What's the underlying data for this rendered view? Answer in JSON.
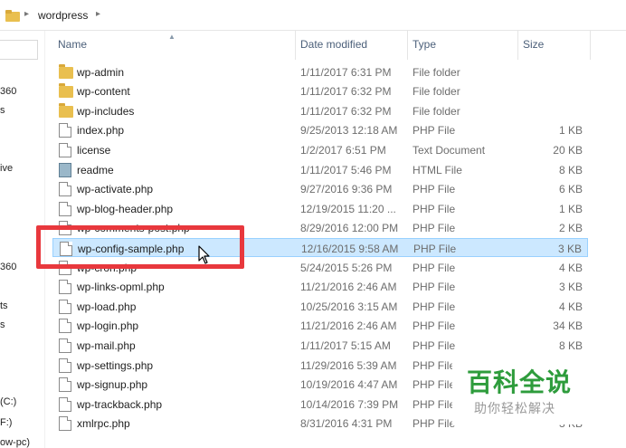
{
  "address": {
    "path": "wordpress"
  },
  "nav": {
    "fragments": [
      "360",
      "s",
      "ive",
      "360",
      "ts",
      "s",
      "(C:)",
      "F:)",
      "ow-pc)"
    ]
  },
  "columns": {
    "name": "Name",
    "date": "Date modified",
    "type": "Type",
    "size": "Size"
  },
  "files": [
    {
      "name": "wp-admin",
      "date": "1/11/2017 6:31 PM",
      "type": "File folder",
      "size": "",
      "icon": "folder-icon"
    },
    {
      "name": "wp-content",
      "date": "1/11/2017 6:32 PM",
      "type": "File folder",
      "size": "",
      "icon": "folder-icon"
    },
    {
      "name": "wp-includes",
      "date": "1/11/2017 6:32 PM",
      "type": "File folder",
      "size": "",
      "icon": "folder-icon"
    },
    {
      "name": "index.php",
      "date": "9/25/2013 12:18 AM",
      "type": "PHP File",
      "size": "1 KB",
      "icon": "php-file-icon"
    },
    {
      "name": "license",
      "date": "1/2/2017 6:51 PM",
      "type": "Text Document",
      "size": "20 KB",
      "icon": "text-file-icon"
    },
    {
      "name": "readme",
      "date": "1/11/2017 5:46 PM",
      "type": "HTML File",
      "size": "8 KB",
      "icon": "html-file-icon"
    },
    {
      "name": "wp-activate.php",
      "date": "9/27/2016 9:36 PM",
      "type": "PHP File",
      "size": "6 KB",
      "icon": "php-file-icon"
    },
    {
      "name": "wp-blog-header.php",
      "date": "12/19/2015 11:20 ...",
      "type": "PHP File",
      "size": "1 KB",
      "icon": "php-file-icon"
    },
    {
      "name": "wp-comments-post.php",
      "date": "8/29/2016 12:00 PM",
      "type": "PHP File",
      "size": "2 KB",
      "icon": "php-file-icon"
    },
    {
      "name": "wp-config-sample.php",
      "date": "12/16/2015 9:58 AM",
      "type": "PHP File",
      "size": "3 KB",
      "icon": "php-file-icon",
      "selected": true
    },
    {
      "name": "wp-cron.php",
      "date": "5/24/2015 5:26 PM",
      "type": "PHP File",
      "size": "4 KB",
      "icon": "php-file-icon"
    },
    {
      "name": "wp-links-opml.php",
      "date": "11/21/2016 2:46 AM",
      "type": "PHP File",
      "size": "3 KB",
      "icon": "php-file-icon"
    },
    {
      "name": "wp-load.php",
      "date": "10/25/2016 3:15 AM",
      "type": "PHP File",
      "size": "4 KB",
      "icon": "php-file-icon"
    },
    {
      "name": "wp-login.php",
      "date": "11/21/2016 2:46 AM",
      "type": "PHP File",
      "size": "34 KB",
      "icon": "php-file-icon"
    },
    {
      "name": "wp-mail.php",
      "date": "1/11/2017 5:15 AM",
      "type": "PHP File",
      "size": "8 KB",
      "icon": "php-file-icon"
    },
    {
      "name": "wp-settings.php",
      "date": "11/29/2016 5:39 AM",
      "type": "PHP File",
      "size": "16 KB",
      "icon": "php-file-icon"
    },
    {
      "name": "wp-signup.php",
      "date": "10/19/2016 4:47 AM",
      "type": "PHP File",
      "size": "30 KB",
      "icon": "php-file-icon"
    },
    {
      "name": "wp-trackback.php",
      "date": "10/14/2016 7:39 PM",
      "type": "PHP File",
      "size": "5 KB",
      "icon": "php-file-icon"
    },
    {
      "name": "xmlrpc.php",
      "date": "8/31/2016 4:31 PM",
      "type": "PHP File",
      "size": "3 KB",
      "icon": "php-file-icon"
    }
  ],
  "watermark": {
    "title": "百科全说",
    "subtitle": "助你轻松解决"
  }
}
